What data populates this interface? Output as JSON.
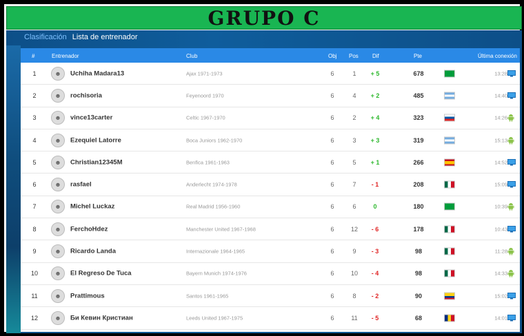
{
  "banner": {
    "title": "GRUPO C"
  },
  "tabs": [
    {
      "label": "Clasificación",
      "active": true
    },
    {
      "label": "Lista de entrenador",
      "active": false
    }
  ],
  "columns": {
    "rank": "#",
    "coach": "Entrenador",
    "club": "Club",
    "obj": "Obj",
    "pos": "Pos",
    "dif": "Dif",
    "pte": "Pte",
    "last": "Última conexión"
  },
  "rows": [
    {
      "rank": "1",
      "name": "Uchiha Madara13",
      "club": "Ajax 1971-1973",
      "obj": "6",
      "pos": "1",
      "dif": "+ 5",
      "dif_sign": "pos",
      "pte": "678",
      "flag": "br",
      "time": "13:28",
      "device": "desktop"
    },
    {
      "rank": "2",
      "name": "rochisoria",
      "club": "Feyenoord 1970",
      "obj": "6",
      "pos": "4",
      "dif": "+ 2",
      "dif_sign": "pos",
      "pte": "485",
      "flag": "ar",
      "time": "14:40",
      "device": "desktop"
    },
    {
      "rank": "3",
      "name": "vince13carter",
      "club": "Celtic 1967-1970",
      "obj": "6",
      "pos": "2",
      "dif": "+ 4",
      "dif_sign": "pos",
      "pte": "323",
      "flag": "si",
      "time": "14:26",
      "device": "android"
    },
    {
      "rank": "4",
      "name": "Ezequiel Latorre",
      "club": "Boca Juniors 1962-1970",
      "obj": "6",
      "pos": "3",
      "dif": "+ 3",
      "dif_sign": "pos",
      "pte": "319",
      "flag": "ar",
      "time": "15:13",
      "device": "android"
    },
    {
      "rank": "5",
      "name": "Christian12345M",
      "club": "Benfica 1961-1963",
      "obj": "6",
      "pos": "5",
      "dif": "+ 1",
      "dif_sign": "pos",
      "pte": "266",
      "flag": "es",
      "time": "14:52",
      "device": "desktop"
    },
    {
      "rank": "6",
      "name": "rasfael",
      "club": "Anderlecht 1974-1978",
      "obj": "6",
      "pos": "7",
      "dif": "- 1",
      "dif_sign": "neg",
      "pte": "208",
      "flag": "mx",
      "time": "15:09",
      "device": "desktop"
    },
    {
      "rank": "7",
      "name": "Michel Luckaz",
      "club": "Real Madrid 1956-1960",
      "obj": "6",
      "pos": "6",
      "dif": "0",
      "dif_sign": "zero",
      "pte": "180",
      "flag": "br",
      "time": "10:39",
      "device": "android"
    },
    {
      "rank": "8",
      "name": "FerchoHdez",
      "club": "Manchester United 1967-1968",
      "obj": "6",
      "pos": "12",
      "dif": "- 6",
      "dif_sign": "neg",
      "pte": "178",
      "flag": "mx",
      "time": "10:43",
      "device": "desktop"
    },
    {
      "rank": "9",
      "name": "Ricardo Landa",
      "club": "Internazionale 1964-1965",
      "obj": "6",
      "pos": "9",
      "dif": "- 3",
      "dif_sign": "neg",
      "pte": "98",
      "flag": "mx",
      "time": "11:28",
      "device": "android"
    },
    {
      "rank": "10",
      "name": "El Regreso De Tuca",
      "club": "Bayern Munich 1974-1976",
      "obj": "6",
      "pos": "10",
      "dif": "- 4",
      "dif_sign": "neg",
      "pte": "98",
      "flag": "mx",
      "time": "14:33",
      "device": "android"
    },
    {
      "rank": "11",
      "name": "Prattimous",
      "club": "Santos 1961-1965",
      "obj": "6",
      "pos": "8",
      "dif": "- 2",
      "dif_sign": "neg",
      "pte": "90",
      "flag": "co",
      "time": "15:02",
      "device": "desktop"
    },
    {
      "rank": "12",
      "name": "Би Кевин Кристиан",
      "club": "Leeds United 1967-1975",
      "obj": "6",
      "pos": "11",
      "dif": "- 5",
      "dif_sign": "neg",
      "pte": "68",
      "flag": "ro",
      "time": "14:01",
      "device": "desktop"
    }
  ],
  "colors": {
    "header_bg": "#2a89e6",
    "banner_bg": "#19b552",
    "panel_bg": "#0f5d9c",
    "positive": "#2eb82e",
    "negative": "#e02424"
  }
}
